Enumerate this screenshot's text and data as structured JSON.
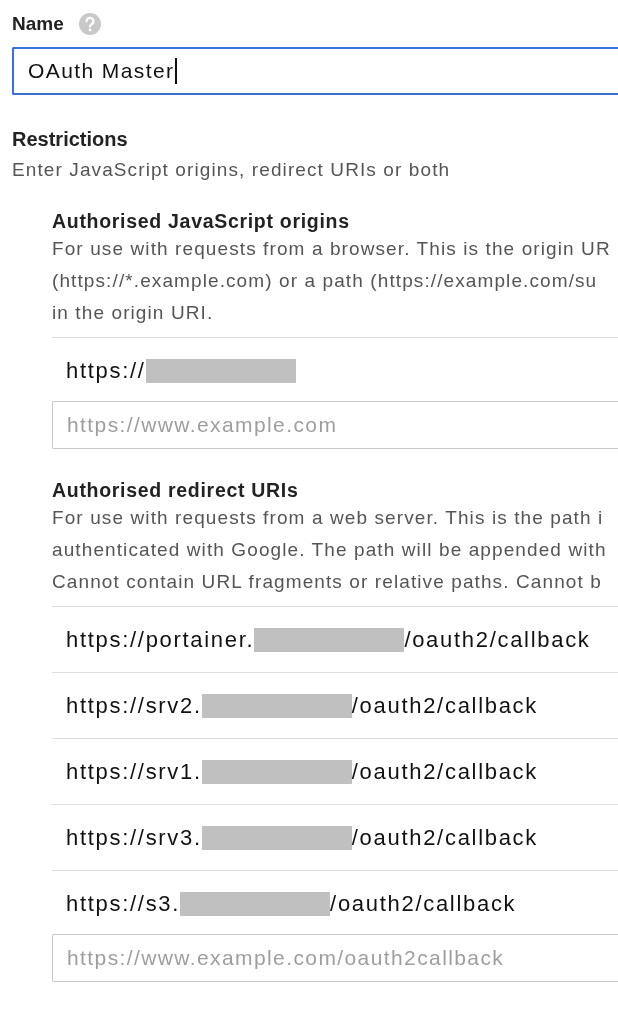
{
  "name_field": {
    "label": "Name",
    "value": "OAuth Master",
    "focused": true
  },
  "restrictions": {
    "title": "Restrictions",
    "subtitle": "Enter JavaScript origins, redirect URIs or both"
  },
  "sections": [
    {
      "title": "Authorised JavaScript origins",
      "description": [
        "For use with requests from a browser. This is the origin UR",
        "(https://*.example.com) or a path (https://example.com/su",
        "in the origin URI."
      ],
      "entries": [
        {
          "prefix": "https://",
          "redacted": true
        }
      ],
      "placeholder": "https://www.example.com"
    },
    {
      "title": "Authorised redirect URIs",
      "description": [
        "For use with requests from a web server. This is the path i",
        "authenticated with Google. The path will be appended with",
        "Cannot contain URL fragments or relative paths. Cannot b"
      ],
      "entries": [
        {
          "prefix": "https://portainer.",
          "redacted": true,
          "suffix": "/oauth2/callback"
        },
        {
          "prefix": "https://srv2.",
          "redacted": true,
          "suffix": "/oauth2/callback"
        },
        {
          "prefix": "https://srv1.",
          "redacted": true,
          "suffix": "/oauth2/callback"
        },
        {
          "prefix": "https://srv3.",
          "redacted": true,
          "suffix": "/oauth2/callback"
        },
        {
          "prefix": "https://s3.",
          "redacted": true,
          "suffix": "/oauth2/callback"
        }
      ],
      "placeholder": "https://www.example.com/oauth2callback"
    }
  ]
}
